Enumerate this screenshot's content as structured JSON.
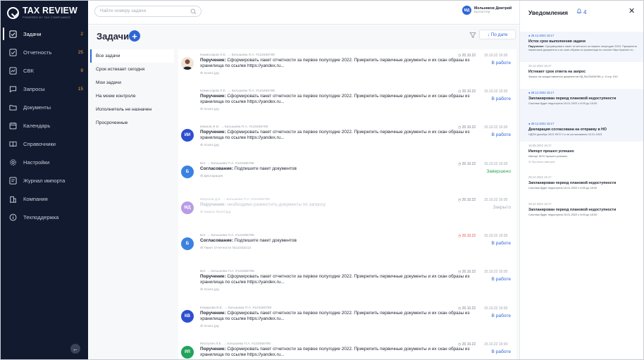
{
  "app": {
    "logo_name": "TAX REVIEW",
    "logo_tagline": "POWERED BY TAX COMPLIANCE"
  },
  "sidebar": {
    "items": [
      {
        "label": "Задачи",
        "count": "2",
        "icon": "checkbox-icon",
        "active": true
      },
      {
        "label": "Отчетность",
        "count": "25",
        "icon": "report-icon",
        "active": false
      },
      {
        "label": "СВК",
        "count": "9",
        "icon": "chart-icon",
        "active": false
      },
      {
        "label": "Запросы",
        "count": "15",
        "icon": "message-icon",
        "active": false
      },
      {
        "label": "Документы",
        "count": "",
        "icon": "folder-icon",
        "active": false
      },
      {
        "label": "Календарь",
        "count": "",
        "icon": "calendar-icon",
        "active": false
      },
      {
        "label": "Справочники",
        "count": "",
        "icon": "book-icon",
        "active": false
      },
      {
        "label": "Настройки",
        "count": "",
        "icon": "gear-icon",
        "active": false
      },
      {
        "label": "Журнал импорта",
        "count": "",
        "icon": "import-icon",
        "active": false
      },
      {
        "label": "Компания",
        "count": "",
        "icon": "building-icon",
        "active": false
      },
      {
        "label": "Техподдержка",
        "count": "",
        "icon": "info-icon",
        "active": false
      }
    ],
    "collapse_glyph": "←"
  },
  "topbar": {
    "search_placeholder": "Найти номеру задачи",
    "user_initials": "МД",
    "user_name": "Мельников Дмитрий",
    "user_role": "Бухгалтер"
  },
  "main": {
    "title": "Задачи",
    "add_glyph": "+",
    "sort_label": "↓ По дате",
    "filters": [
      {
        "label": "Все задачи",
        "active": true
      },
      {
        "label": "Срок истекает сегодня",
        "active": false
      },
      {
        "label": "Мои задачи",
        "active": false
      },
      {
        "label": "На моем контроле",
        "active": false
      },
      {
        "label": "Исполнитель не назначен",
        "active": false
      },
      {
        "label": "Просроченные",
        "active": false
      }
    ]
  },
  "tasks": [
    {
      "avatar": "photo",
      "avatar_color": "#7a4e3a",
      "meta": "Комиссаров Л.Е. → Катышева П.А.  #123456789",
      "type": "Поручение:",
      "text": "Сформировать пакет отчетности за первое полугодие 2022. Прикрепить первичные документы и их скан образы из хранилища по ссылке https://yandex.ru...",
      "attach": "Scan1.jpg",
      "due": "◷ 20.10.22",
      "due_overdue": false,
      "created": "15.10.22 10:30",
      "status": "В работе",
      "status_kind": "work",
      "muted": false
    },
    {
      "avatar": "",
      "avatar_color": "",
      "meta": "Комиссаров Л.Е. → Катышева П.А.  #123456789",
      "type": "Поручение:",
      "text": "Сформировать пакет отчетности за первое полугодие 2022. Прикрепить первичные документы и их скан образы из хранилища по ссылке https://yandex.ru...",
      "attach": "Scan1.jpg",
      "due": "◷ 20.10.22",
      "due_overdue": false,
      "created": "15.10.22 10:30",
      "status": "В работе",
      "status_kind": "work",
      "muted": false
    },
    {
      "avatar": "ИИ",
      "avatar_color": "#2f4fd0",
      "meta": "Иванов И.И. → Катышева П.А.  #123456789",
      "type": "Поручение:",
      "text": "Сформировать пакет отчетности за первое полугодие 2022. Прикрепить первичные документы и их скан образы из хранилища по ссылке https://yandex.ru...",
      "attach": "Scan1.jpg",
      "due": "◷ 20.10.22",
      "due_overdue": false,
      "created": "15.10.22 10:30",
      "status": "В работе",
      "status_kind": "work",
      "muted": false
    },
    {
      "avatar": "Б",
      "avatar_color": "#3b82e0",
      "meta": "Бот → Катышева П.А.  #123456789",
      "type": "Согласование:",
      "text": "Подпишите пакет документов",
      "attach": "Декларация",
      "due": "◷ 20.10.22",
      "due_overdue": false,
      "created": "15.10.22 10:30",
      "status": "Завершено",
      "status_kind": "done",
      "muted": false
    },
    {
      "avatar": "МД",
      "avatar_color": "#8a5bd6",
      "meta": "Мерзлов Д.Е. → Катышева П.А.  #123456789",
      "type": "Поручение:",
      "text": "необходимо разместить документы по запросу",
      "attach": "Запрос №123.jpg",
      "due": "◷ 20.10.22",
      "due_overdue": false,
      "created": "15.10.22 10:30",
      "status": "Закрыто",
      "status_kind": "closed",
      "muted": true
    },
    {
      "avatar": "Б",
      "avatar_color": "#3b82e0",
      "meta": "Бот → Катышева П.А.  #123456789",
      "type": "Согласование:",
      "text": "Подпишите пакет документов",
      "attach": "Пакет отчетности №12333213",
      "due": "◷ 20.10.22",
      "due_overdue": true,
      "created": "15.10.22 10:30",
      "status": "В работе",
      "status_kind": "work",
      "muted": false
    },
    {
      "avatar": "",
      "avatar_color": "",
      "meta": "Бот → Катышева П.А.  #123456789",
      "type": "Поручение:",
      "text": "Сформировать пакет отчетности за первое полугодие 2022. Прикрепить первичные документы и их скан образы из хранилища по ссылке https://yandex.ru...",
      "attach": "Scan1.jpg",
      "due": "◷ 20.10.22",
      "due_overdue": false,
      "created": "15.10.22 10:30",
      "status": "В работе",
      "status_kind": "work",
      "muted": false
    },
    {
      "avatar": "КВ",
      "avatar_color": "#2f4fd0",
      "meta": "Комарова В.Е. → Катышева П.А.  #123456789",
      "type": "Поручение:",
      "text": "Сформировать пакет отчетности за первое полугодие 2022. Прикрепить первичные документы и их скан образы из хранилища по ссылке https://yandex.ru...",
      "attach": "Scan1.jpg",
      "due": "◷ 20.10.22",
      "due_overdue": false,
      "created": "15.10.22 10:30",
      "status": "В работе",
      "status_kind": "work",
      "muted": false
    },
    {
      "avatar": "РЛ",
      "avatar_color": "#21a35b",
      "meta": "Распутин Л.Е. → Катышева П.А.  #123456789",
      "type": "Поручение:",
      "text": "Сформировать пакет отчетности за первое полугодие 2022. Прикрепить первичные документы и их скан образы из хранилища по ссылке https://yandex.ru...",
      "attach": "Scan1.jpg",
      "due": "◷ 20.10.22",
      "due_overdue": false,
      "created": "15.10.22 10:30",
      "status": "В работе",
      "status_kind": "work",
      "muted": false
    }
  ],
  "notifications": {
    "title": "Уведомления",
    "bell_glyph": "🔔",
    "count": "4",
    "close_glyph": "✕",
    "items": [
      {
        "date": "● 29.12.2022 15:17",
        "title": "Истек срок выполнения задачи",
        "body_bold": "Поручение:",
        "body": "Сформировать пакет отчетности за первое полугодие 2023. Прикрепить первичные документы и их скан образы из хранилища по ссылке https://yandex.ru...",
        "unread": true
      },
      {
        "date": "29.12.2022 15:17",
        "title": "Истекает срок ответа на запрос",
        "body_bold": "",
        "body": "Запрос на предоставление документов  НД №123456789, р. 5 стр. 010",
        "unread": false
      },
      {
        "date": "● 29.12.2022 15:17",
        "title": "Запланирован период плановой недоступности",
        "body_bold": "",
        "body": "Система будет недоступна 15.01.2022 с 6:00 до 18:00",
        "unread": true
      },
      {
        "date": "● 29.12.2022 15:17",
        "title": "Декларация согласована на отправку в НО",
        "body_bold": "",
        "body": "НДПИ декабрь 2022 9972 0 к на согласовании 10.01.2023",
        "unread": true
      },
      {
        "date": "16.08.2022 16:17",
        "title": "Импорт прошел успешно",
        "body_bold": "",
        "body": "Импорт ЖХО прошел успешно\nПротокол импорта",
        "unread": false
      },
      {
        "date": "29.12.2022 15:17",
        "title": "Запланирован период плановой недоступности",
        "body_bold": "",
        "body": "Система будет недоступна 15.01.2022 с 6:00 до 18:00",
        "unread": false
      },
      {
        "date": "29.12.2022 15:17",
        "title": "Запланирован период плановой недоступности",
        "body_bold": "",
        "body": "Система будет недоступна 15.01.2022 с 6:00 до 18:00",
        "unread": false
      }
    ]
  },
  "colors": {
    "sidebar_bg": "#121a30",
    "accent": "#2f66d6",
    "count": "#f0ac2f",
    "status_done": "#2ea44f",
    "overdue": "#e34b4b"
  }
}
